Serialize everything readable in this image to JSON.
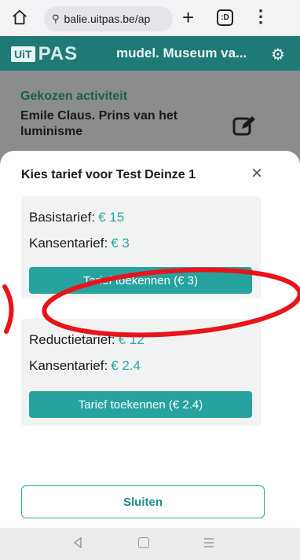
{
  "browser": {
    "url": "balie.uitpas.be/ap",
    "tabs_count": ":D"
  },
  "app": {
    "logo_uit": "UiT",
    "logo_pas": "PAS",
    "museum_name": "mudel. Museum va...",
    "selected_activity_label": "Gekozen activiteit",
    "selected_activity_title": "Emile Claus. Prins van het luminisme"
  },
  "modal": {
    "title": "Kies tarief voor Test Deinze 1",
    "close_symbol": "×",
    "cards": [
      {
        "base_label": "Basistarief:",
        "base_price": "€ 15",
        "kansen_label": "Kansentarief:",
        "kansen_price": "€ 3",
        "button_label": "Tarief toekennen (€ 3)"
      },
      {
        "base_label": "Reductietarief:",
        "base_price": "€ 12",
        "kansen_label": "Kansentarief:",
        "kansen_price": "€ 2.4",
        "button_label": "Tarief toekennen (€ 2.4)"
      }
    ],
    "close_button_label": "Sluiten"
  },
  "colors": {
    "accent": "#26a39e",
    "header": "#1f7a76",
    "annotation": "#e8141a"
  }
}
